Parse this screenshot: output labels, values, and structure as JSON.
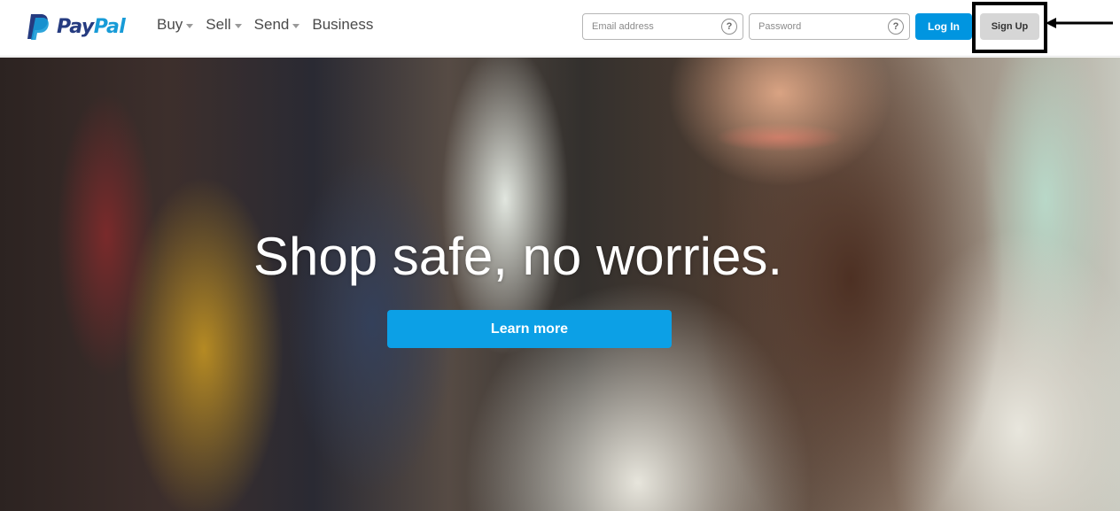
{
  "brand": {
    "name_part1": "Pay",
    "name_part2": "Pal",
    "colors": {
      "dark_blue": "#253b80",
      "light_blue": "#179bd7"
    }
  },
  "nav": {
    "items": [
      {
        "label": "Buy",
        "has_dropdown": true
      },
      {
        "label": "Sell",
        "has_dropdown": true
      },
      {
        "label": "Send",
        "has_dropdown": true
      },
      {
        "label": "Business",
        "has_dropdown": false
      }
    ]
  },
  "login_form": {
    "email": {
      "placeholder": "Email address",
      "value": "",
      "help_icon": "question-icon",
      "help_label": "?"
    },
    "password": {
      "placeholder": "Password",
      "value": "",
      "help_icon": "question-icon",
      "help_label": "?"
    },
    "login_label": "Log In",
    "signup_label": "Sign Up"
  },
  "annotation": {
    "highlight": "sign-up-button",
    "pointer": "arrow-left-icon",
    "color": "#000000"
  },
  "hero": {
    "title": "Shop safe, no worries.",
    "cta_label": "Learn more",
    "cta_color": "#0ca0e6"
  }
}
